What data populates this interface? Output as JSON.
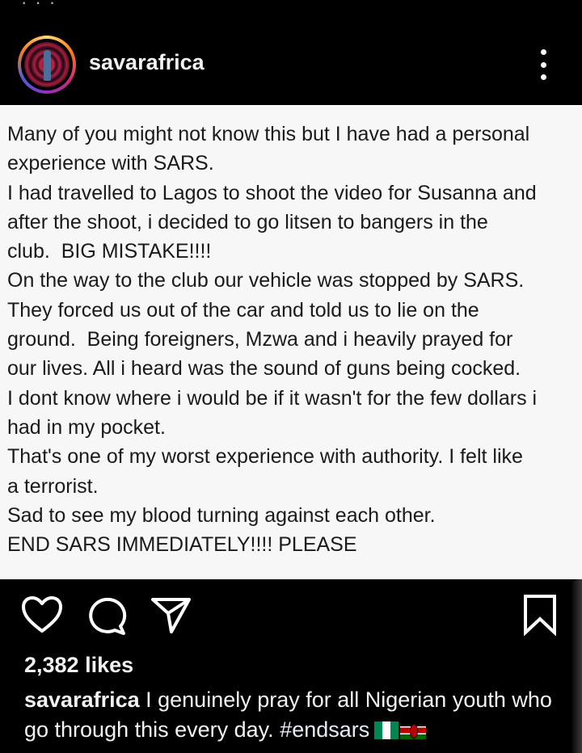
{
  "post": {
    "username": "savarafrica",
    "image_text_lines": [
      "Many of you might not know this but I have had a personal",
      "experience with SARS.",
      "I had travelled to Lagos to shoot the video for Susanna and",
      "after the shoot, i decided to go litsen to bangers in the",
      "club.  BIG MISTAKE!!!!",
      "On the way to the club our vehicle was stopped by SARS.",
      "They forced us out of the car and told us to lie on the",
      "ground.  Being foreigners, Mzwa and i heavily prayed for",
      "our lives. All i heard was the sound of guns being cocked.",
      "I dont know where i would be if it wasn't for the few dollars i",
      "had in my pocket.",
      "That's one of my worst experience with authority. I felt like",
      "a terrorist.",
      "Sad to see my blood turning against each other.",
      "END SARS IMMEDIATELY!!!! PLEASE"
    ],
    "likes_text": "2,382 likes",
    "caption": {
      "username": "savarafrica",
      "text": " I genuinely pray for all Nigerian youth who go through this every day.  ",
      "hashtag": "#endsars"
    }
  },
  "icons": {
    "more": "kebab-menu-icon",
    "like": "heart-icon",
    "comment": "comment-bubble-icon",
    "share": "paper-plane-icon",
    "save": "bookmark-icon",
    "flags": [
      "nigeria-flag-emoji",
      "kenya-flag-emoji"
    ]
  },
  "colors": {
    "background": "#000000",
    "post_image_background": "#f7f7f7",
    "post_text": "#1a1a1a",
    "text": "#f2f2f2"
  }
}
